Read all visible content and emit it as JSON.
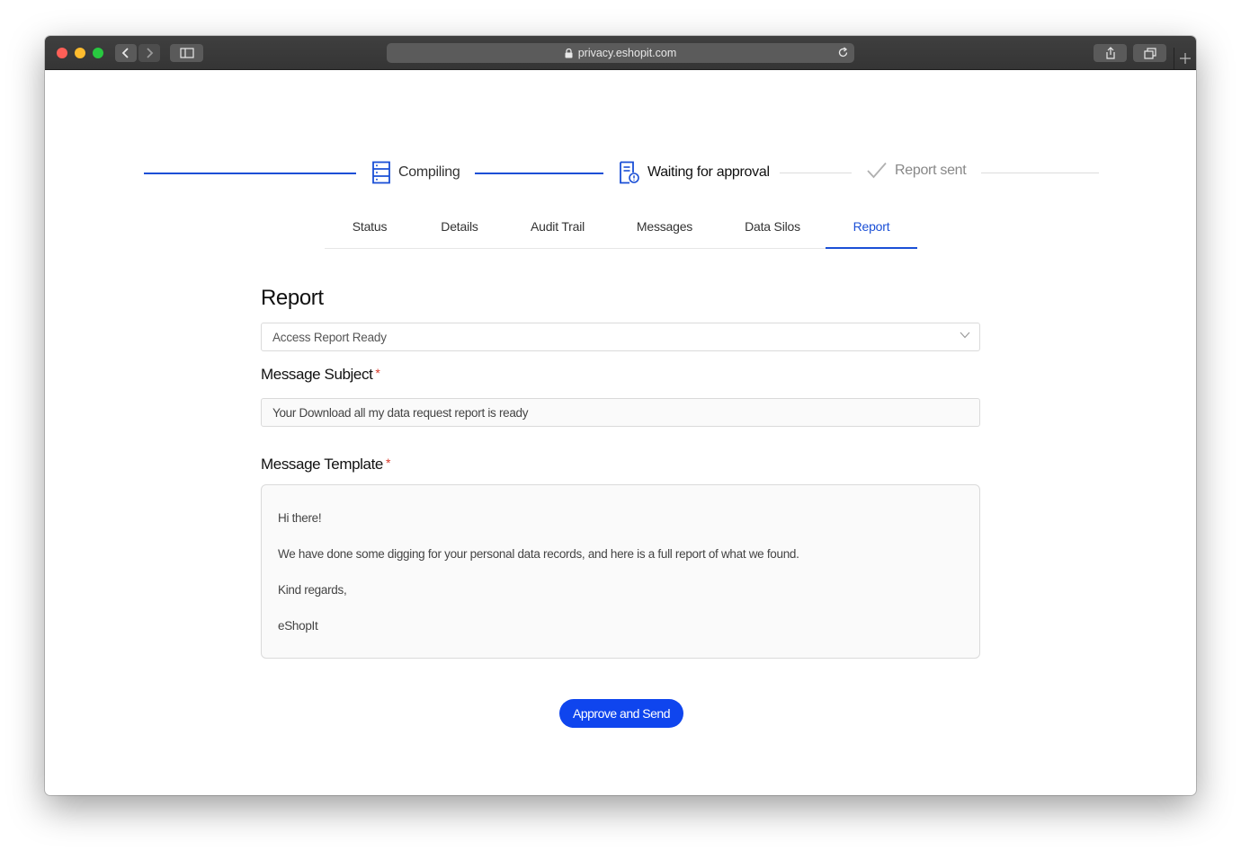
{
  "browser": {
    "url": "privacy.eshopit.com"
  },
  "stepper": {
    "steps": [
      {
        "label": "Compiling",
        "state": "done",
        "icon": "server-icon"
      },
      {
        "label": "Waiting for approval",
        "state": "current",
        "icon": "document-clock-icon"
      },
      {
        "label": "Report sent",
        "state": "pending",
        "icon": "checkmark-icon"
      }
    ]
  },
  "tabs": [
    {
      "label": "Status"
    },
    {
      "label": "Details"
    },
    {
      "label": "Audit Trail"
    },
    {
      "label": "Messages"
    },
    {
      "label": "Data Silos"
    },
    {
      "label": "Report"
    }
  ],
  "active_tab": "Report",
  "report": {
    "title": "Report",
    "template_select": "Access Report Ready",
    "subject_label": "Message Subject",
    "subject_value": "Your Download all my data request report is ready",
    "template_label": "Message Template",
    "required_marker": "*",
    "template_lines": [
      "Hi there!",
      "We have done some digging for your personal data records, and here is a full report of what we found.",
      "Kind regards,",
      "eShopIt"
    ],
    "submit_label": "Approve and Send"
  },
  "colors": {
    "accent": "#1a4fd6",
    "button": "#0f45ee",
    "required": "#d93a2b"
  }
}
